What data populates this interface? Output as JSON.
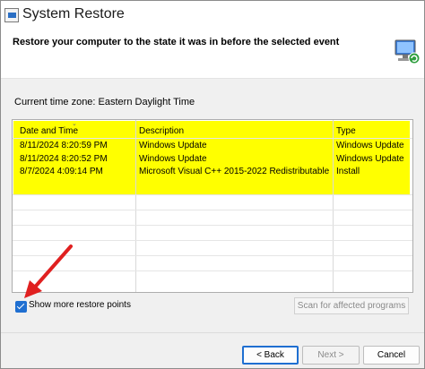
{
  "window": {
    "title": "System Restore",
    "icon": "system-restore-icon",
    "header_text": "Restore your computer to the state it was in before the selected event"
  },
  "timezone_label": "Current time zone: Eastern Daylight Time",
  "table": {
    "columns": [
      "Date and Time",
      "Description",
      "Type"
    ],
    "rows": [
      {
        "date": "8/11/2024 8:20:59 PM",
        "description": "Windows Update",
        "type": "Windows Update"
      },
      {
        "date": "8/11/2024 8:20:52 PM",
        "description": "Windows Update",
        "type": "Windows Update"
      },
      {
        "date": "8/7/2024 4:09:14 PM",
        "description": "Microsoft Visual C++ 2015-2022 Redistributable ...",
        "type": "Install"
      }
    ],
    "highlight_color": "#ffff00"
  },
  "options": {
    "show_more_label": "Show more restore points",
    "show_more_checked": true,
    "scan_button": "Scan for affected programs"
  },
  "buttons": {
    "back": "< Back",
    "next": "Next >",
    "cancel": "Cancel"
  },
  "accent_color": "#1f6fd1",
  "annotation_color": "#e02020"
}
